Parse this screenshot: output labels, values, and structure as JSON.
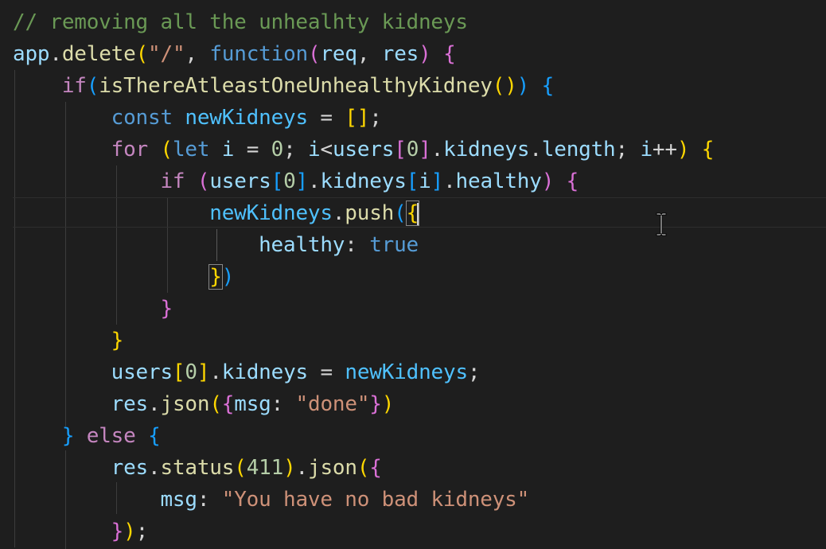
{
  "editor": {
    "colors": {
      "background": "#1e1e1e",
      "comment": "#6a9955",
      "keyword": "#569cd6",
      "control": "#c586c0",
      "function": "#dcdcaa",
      "variable": "#9cdcfe",
      "string": "#ce9178",
      "bracket_gold": "#ffd700",
      "bracket_purple": "#da70d6",
      "bracket_blue": "#179fff"
    },
    "cursor_icon": "text-cursor-ibeam-icon",
    "lines": [
      "// removing all the unhealhty kidneys",
      "app.delete(\"/\", function(req, res) {",
      "    if(isThereAtleastOneUnhealthyKidney()) {",
      "        const newKidneys = [];",
      "        for (let i = 0; i<users[0].kidneys.length; i++) {",
      "            if (users[0].kidneys[i].healthy) {",
      "                newKidneys.push({",
      "                    healthy: true",
      "                })",
      "            }",
      "        }",
      "        users[0].kidneys = newKidneys;",
      "        res.json({msg: \"done\"})",
      "    } else {",
      "        res.status(411).json({",
      "            msg: \"You have no bad kidneys\"",
      "        });"
    ]
  }
}
